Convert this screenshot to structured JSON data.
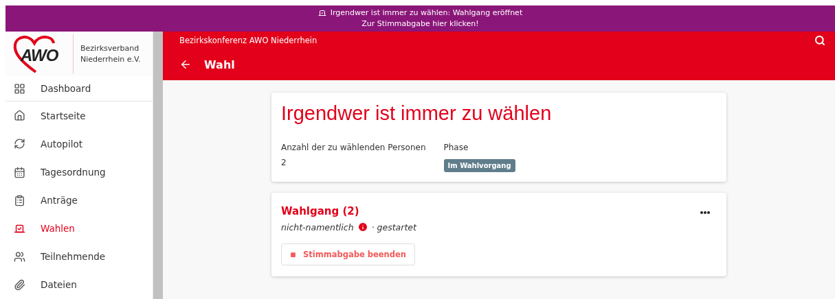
{
  "banner": {
    "line_1": "Irgendwer ist immer zu wählen: Wahlgang eröffnet",
    "line_2": "Zur Stimmabgabe hier klicken!"
  },
  "logo": {
    "mark": "AWO",
    "line_1": "Bezirksverband",
    "line_2": "Niederrhein e.V."
  },
  "sidebar": {
    "items": [
      {
        "label": "Dashboard",
        "selected": false
      },
      {
        "label": "Startseite",
        "selected": false
      },
      {
        "label": "Autopilot",
        "selected": false
      },
      {
        "label": "Tagesordnung",
        "selected": false
      },
      {
        "label": "Anträge",
        "selected": false
      },
      {
        "label": "Wahlen",
        "selected": true
      },
      {
        "label": "Teilnehmende",
        "selected": false
      },
      {
        "label": "Dateien",
        "selected": false
      }
    ]
  },
  "header": {
    "meeting": "Bezirkskonferenz AWO Niederrhein",
    "title": "Wahl"
  },
  "election": {
    "title": "Irgendwer ist immer zu wählen",
    "fields": [
      {
        "label": "Anzahl der zu wählenden Personen",
        "value": "2",
        "kind": "text"
      },
      {
        "label": "Phase",
        "value": "Im Wahlvorgang",
        "kind": "chip"
      }
    ]
  },
  "ballot": {
    "title": "Wahlgang (2)",
    "method": "nicht-namentlich",
    "state": "· gestartet",
    "button": "Stimmabgabe beenden"
  }
}
